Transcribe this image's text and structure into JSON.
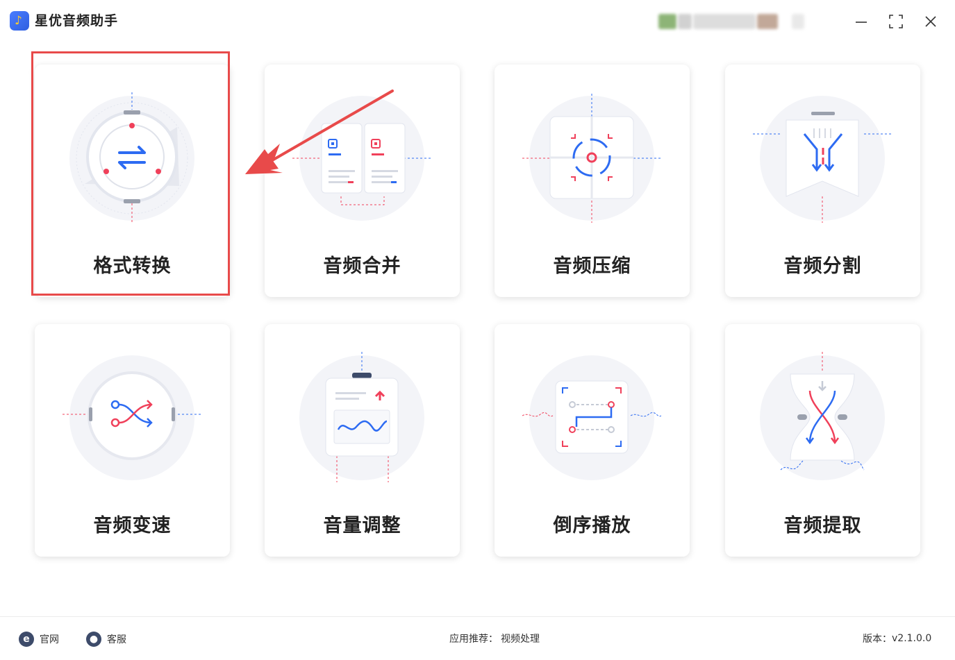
{
  "app": {
    "title": "星优音频助手"
  },
  "window": {
    "minimize": "minimize-icon",
    "maximize": "maximize-icon",
    "close": "close-icon"
  },
  "cards": [
    {
      "label": "格式转换",
      "icon": "format-convert-icon",
      "selected": true
    },
    {
      "label": "音频合并",
      "icon": "audio-merge-icon"
    },
    {
      "label": "音频压缩",
      "icon": "audio-compress-icon"
    },
    {
      "label": "音频分割",
      "icon": "audio-split-icon"
    },
    {
      "label": "音频变速",
      "icon": "audio-speed-icon"
    },
    {
      "label": "音量调整",
      "icon": "volume-adjust-icon"
    },
    {
      "label": "倒序播放",
      "icon": "reverse-play-icon"
    },
    {
      "label": "音频提取",
      "icon": "audio-extract-icon"
    }
  ],
  "footer": {
    "website": "官网",
    "support": "客服",
    "recommend_label": "应用推荐：",
    "recommend_link": "视频处理",
    "version_label": "版本：",
    "version_value": "v2.1.0.0"
  },
  "colors": {
    "accent_blue": "#2d6bf2",
    "accent_red": "#f0405a",
    "highlight": "#e84a4a"
  }
}
